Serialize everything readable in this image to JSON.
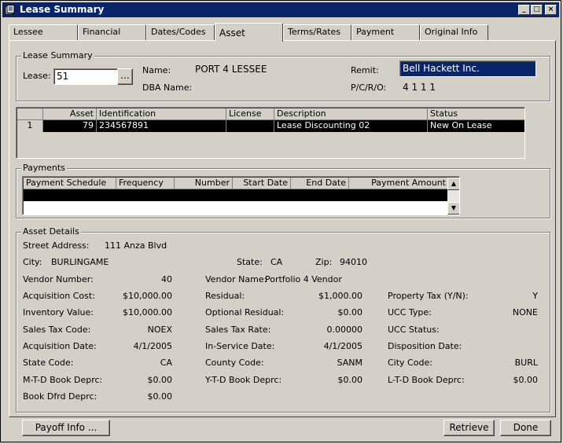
{
  "window": {
    "title": "Lease Summary",
    "controls": {
      "minimize": "_",
      "maximize": "□",
      "close": "×"
    }
  },
  "tabs": [
    "Lessee",
    "Financial",
    "Dates/Codes",
    "Asset",
    "Terms/Rates",
    "Payment",
    "Original Info"
  ],
  "active_tab": "Asset",
  "lease_summary": {
    "group_title": "Lease Summary",
    "lease_label": "Lease:",
    "lease_value": "51",
    "lookup_label": "...",
    "name_label": "Name:",
    "name_value": "PORT 4 LESSEE",
    "dba_label": "DBA Name:",
    "dba_value": "",
    "remit_label": "Remit:",
    "remit_value": "Bell Hackett Inc.",
    "pcro_label": "P/C/R/O:",
    "pcro_value": "4 1 1 1"
  },
  "assets_grid": {
    "columns": [
      "",
      "Asset",
      "Identification",
      "License",
      "Description",
      "Status"
    ],
    "rows": [
      {
        "row_num": "1",
        "asset": "79",
        "identification": "234567891",
        "license": "",
        "description": "Lease Discounting 02",
        "status": "New On Lease"
      }
    ]
  },
  "payments": {
    "group_title": "Payments",
    "columns": [
      "Payment Schedule",
      "Frequency",
      "Number",
      "Start Date",
      "End Date",
      "Payment Amount"
    ]
  },
  "asset_details": {
    "group_title": "Asset Details",
    "street_label": "Street Address:",
    "street_value": "111 Anza Blvd",
    "city_label": "City:",
    "city_value": "BURLINGAME",
    "state_label": "State:",
    "state_value": "CA",
    "zip_label": "Zip:",
    "zip_value": "94010",
    "vendor_number_label": "Vendor Number:",
    "vendor_number_value": "40",
    "vendor_name_label": "Vendor Name:",
    "vendor_name_value": "Portfolio 4 Vendor",
    "acq_cost_label": "Acquisition Cost:",
    "acq_cost_value": "$10,000.00",
    "residual_label": "Residual:",
    "residual_value": "$1,000.00",
    "prop_tax_label": "Property Tax (Y/N):",
    "prop_tax_value": "Y",
    "inv_value_label": "Inventory Value:",
    "inv_value_value": "$10,000.00",
    "opt_residual_label": "Optional Residual:",
    "opt_residual_value": "$0.00",
    "ucc_type_label": "UCC Type:",
    "ucc_type_value": "NONE",
    "sales_tax_code_label": "Sales Tax Code:",
    "sales_tax_code_value": "NOEX",
    "sales_tax_rate_label": "Sales Tax Rate:",
    "sales_tax_rate_value": "0.00000",
    "ucc_status_label": "UCC Status:",
    "ucc_status_value": "",
    "acq_date_label": "Acquisition Date:",
    "acq_date_value": "4/1/2005",
    "in_service_label": "In-Service Date:",
    "in_service_value": "4/1/2005",
    "disp_date_label": "Disposition Date:",
    "disp_date_value": "",
    "state_code_label": "State Code:",
    "state_code_value": "CA",
    "county_code_label": "County Code:",
    "county_code_value": "SANM",
    "city_code_label": "City Code:",
    "city_code_value": "BURL",
    "mtd_label": "M-T-D Book Deprc:",
    "mtd_value": "$0.00",
    "ytd_label": "Y-T-D Book Deprc:",
    "ytd_value": "$0.00",
    "ltd_label": "L-T-D Book Deprc:",
    "ltd_value": "$0.00",
    "dfrd_label": "Book Dfrd Deprc:",
    "dfrd_value": "$0.00"
  },
  "buttons": {
    "payoff": "Payoff Info ...",
    "retrieve": "Retrieve",
    "done": "Done"
  },
  "colors": {
    "title_bar": "#0a246a",
    "remit_bg": "#0a246a",
    "selected_row": "#000000",
    "face": "#d4d0c8"
  }
}
